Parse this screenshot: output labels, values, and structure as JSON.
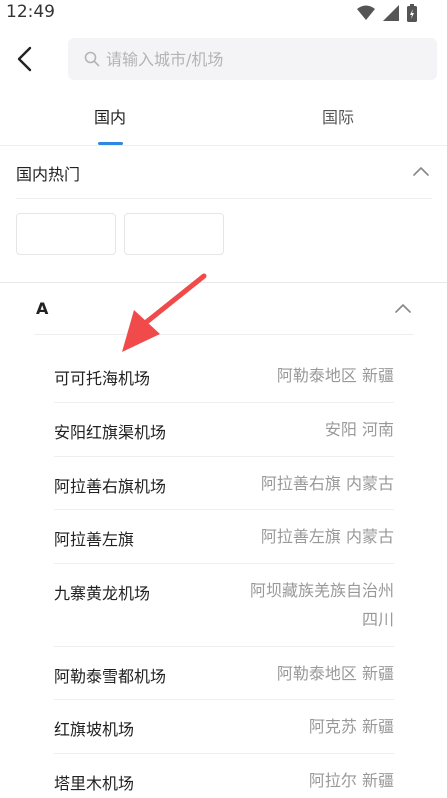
{
  "status": {
    "time": "12:49"
  },
  "search": {
    "placeholder": "请输入城市/机场"
  },
  "tabs": [
    {
      "label": "国内",
      "active": true
    },
    {
      "label": "国际",
      "active": false
    }
  ],
  "hot": {
    "title": "国内热门",
    "chips": [
      "",
      ""
    ]
  },
  "section": {
    "letter": "A",
    "airports": [
      {
        "name": "可可托海机场",
        "location": "阿勒泰地区 新疆"
      },
      {
        "name": "安阳红旗渠机场",
        "location": "安阳 河南"
      },
      {
        "name": "阿拉善右旗机场",
        "location": "阿拉善右旗 内蒙古"
      },
      {
        "name": "阿拉善左旗",
        "location": "阿拉善左旗 内蒙古"
      },
      {
        "name": "九寨黄龙机场",
        "location": "阿坝藏族羌族自治州",
        "location_line2": "四川"
      },
      {
        "name": "阿勒泰雪都机场",
        "location": "阿勒泰地区 新疆"
      },
      {
        "name": "红旗坡机场",
        "location": "阿克苏 新疆"
      },
      {
        "name": "塔里木机场",
        "location": "阿拉尔 新疆"
      }
    ]
  },
  "colors": {
    "accent": "#2e86e6",
    "annotation_arrow": "#f04a4a",
    "muted_text": "#999999"
  }
}
